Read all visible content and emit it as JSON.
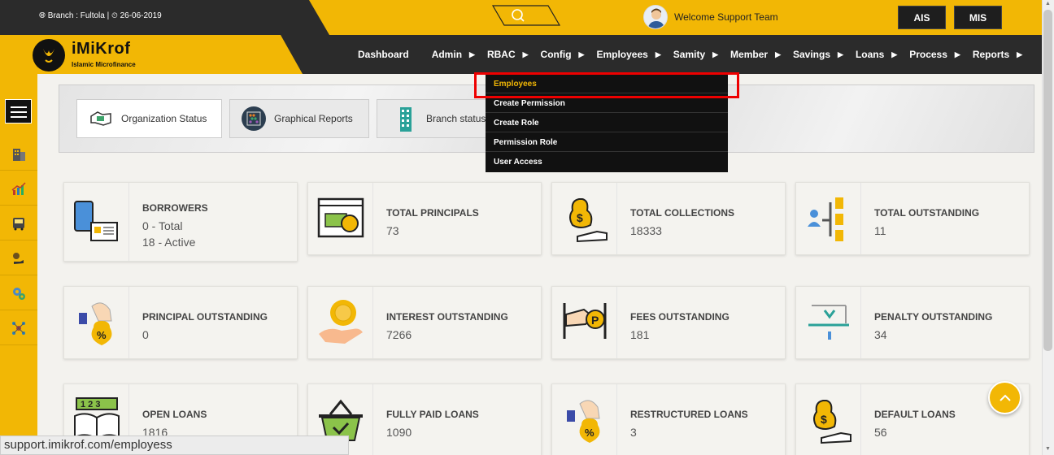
{
  "header": {
    "branch_info": "Branch : Fultola |",
    "date": "26-06-2019",
    "welcome": "Welcome Support Team",
    "buttons": [
      "AIS",
      "MIS"
    ]
  },
  "brand": {
    "name": "iMiKrof",
    "subtitle": "Islamic Microfinance"
  },
  "nav": [
    {
      "label": "Dashboard",
      "has_caret": false
    },
    {
      "label": "Admin",
      "has_caret": true
    },
    {
      "label": "RBAC",
      "has_caret": true
    },
    {
      "label": "Config",
      "has_caret": true
    },
    {
      "label": "Employees",
      "has_caret": true
    },
    {
      "label": "Samity",
      "has_caret": true
    },
    {
      "label": "Member",
      "has_caret": true
    },
    {
      "label": "Savings",
      "has_caret": true
    },
    {
      "label": "Loans",
      "has_caret": true
    },
    {
      "label": "Process",
      "has_caret": true
    },
    {
      "label": "Reports",
      "has_caret": true
    }
  ],
  "dropdown": [
    "Employees",
    "Create Permission",
    "Create Role",
    "Permission Role",
    "User Access"
  ],
  "tabs": [
    "Organization Status",
    "Graphical Reports",
    "Branch status"
  ],
  "cards": [
    {
      "title": "BORROWERS",
      "lines": [
        "0 - Total",
        "18 - Active"
      ]
    },
    {
      "title": "TOTAL PRINCIPALS",
      "lines": [
        "73"
      ]
    },
    {
      "title": "TOTAL COLLECTIONS",
      "lines": [
        "18333"
      ]
    },
    {
      "title": "TOTAL OUTSTANDING",
      "lines": [
        "11"
      ]
    },
    {
      "title": "PRINCIPAL OUTSTANDING",
      "lines": [
        "0"
      ]
    },
    {
      "title": "INTEREST OUTSTANDING",
      "lines": [
        "7266"
      ]
    },
    {
      "title": "FEES OUTSTANDING",
      "lines": [
        "181"
      ]
    },
    {
      "title": "PENALTY OUTSTANDING",
      "lines": [
        "34"
      ]
    },
    {
      "title": "OPEN LOANS",
      "lines": [
        "1816"
      ]
    },
    {
      "title": "FULLY PAID LOANS",
      "lines": [
        "1090"
      ]
    },
    {
      "title": "RESTRUCTURED LOANS",
      "lines": [
        "3"
      ]
    },
    {
      "title": "DEFAULT LOANS",
      "lines": [
        "56"
      ]
    }
  ],
  "status_url": "support.imikrof.com/employess",
  "colors": {
    "brand_yellow": "#f2b705",
    "dark": "#2b2b2b",
    "highlight": "#e00000"
  }
}
